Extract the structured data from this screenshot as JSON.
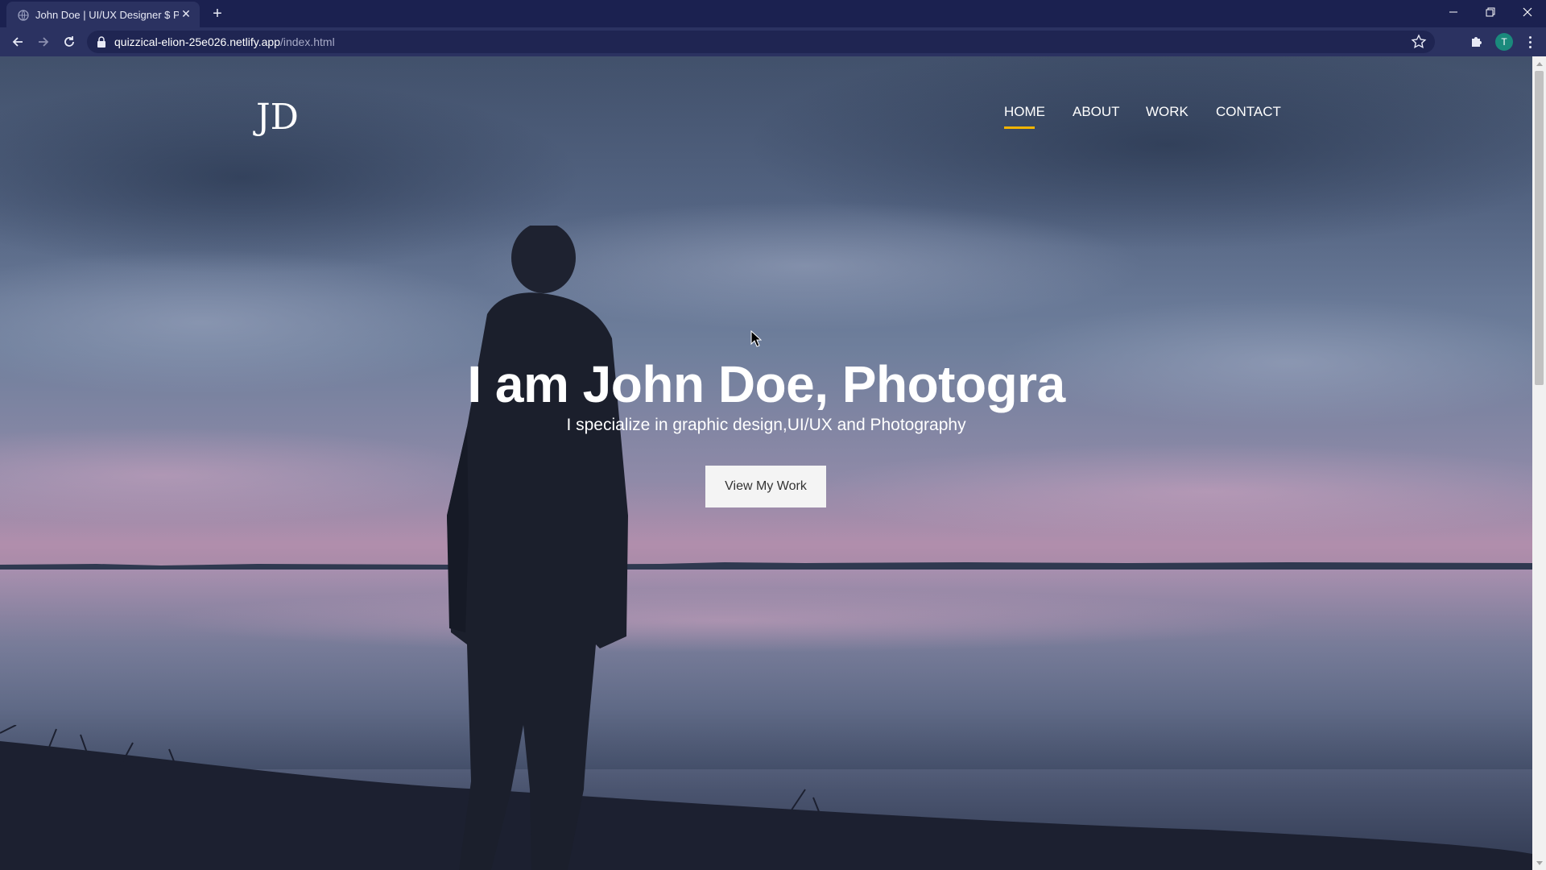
{
  "browser": {
    "tab_title": "John Doe | UI/UX Designer $ Pho",
    "url_host": "quizzical-elion-25e026.netlify.app",
    "url_path": "/index.html",
    "profile_initial": "T"
  },
  "site": {
    "logo_text": "JD",
    "nav": [
      {
        "label": "HOME",
        "active": true
      },
      {
        "label": "ABOUT",
        "active": false
      },
      {
        "label": "WORK",
        "active": false
      },
      {
        "label": "CONTACT",
        "active": false
      }
    ],
    "accent_color": "#f0b400"
  },
  "hero": {
    "title": "I am John Doe, Photogra",
    "subtitle": "I specialize in graphic design,UI/UX and Photography",
    "button_label": "View My Work"
  }
}
